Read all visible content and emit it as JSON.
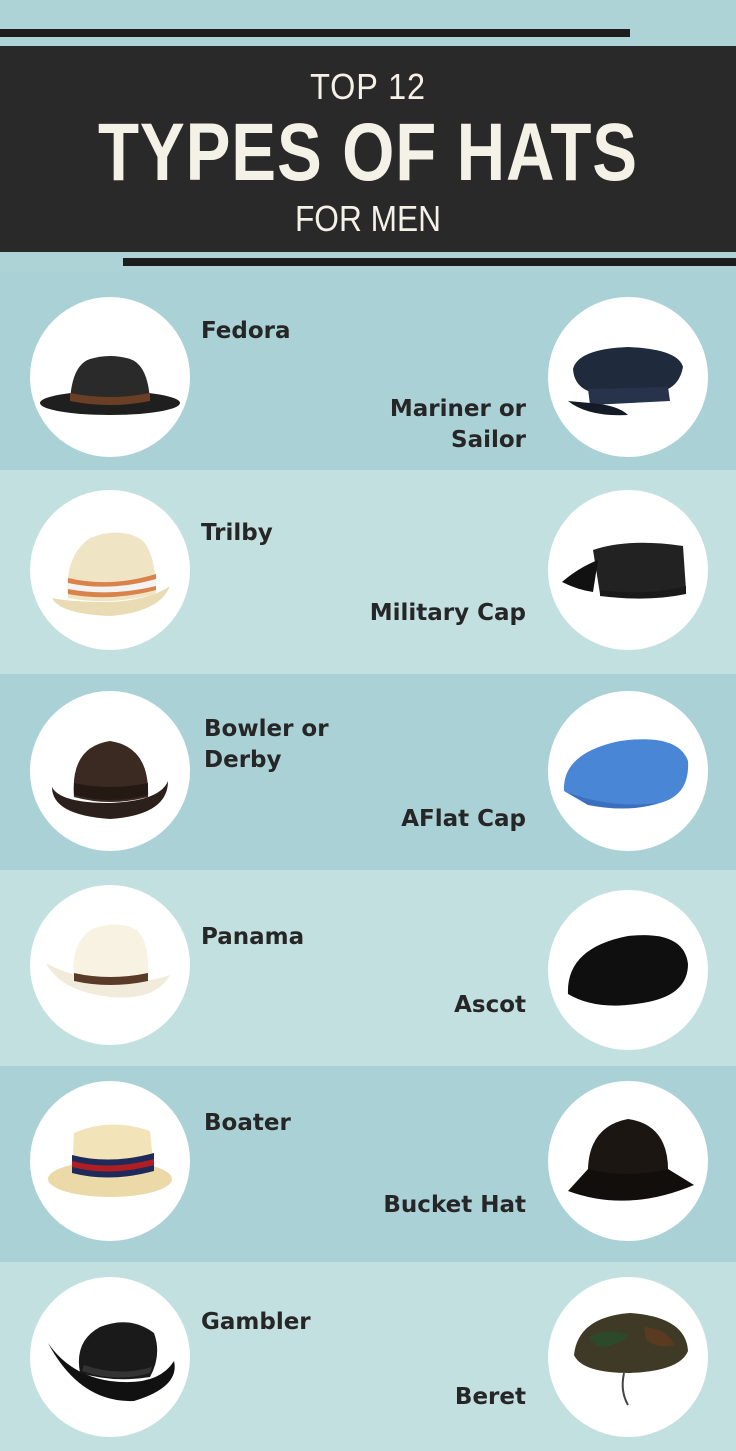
{
  "header": {
    "top": "TOP 12",
    "title": "TYPES OF HATS",
    "sub": "FOR MEN"
  },
  "hats": [
    {
      "left": {
        "name": "Fedora",
        "icon": "fedora-icon"
      },
      "right": {
        "name": "Mariner or\nSailor",
        "icon": "mariner-cap-icon"
      }
    },
    {
      "left": {
        "name": "Trilby",
        "icon": "trilby-icon"
      },
      "right": {
        "name": "Military Cap",
        "icon": "military-cap-icon"
      }
    },
    {
      "left": {
        "name": "Bowler or\nDerby",
        "icon": "bowler-icon"
      },
      "right": {
        "name": "AFlat Cap",
        "icon": "flat-cap-icon"
      }
    },
    {
      "left": {
        "name": "Panama",
        "icon": "panama-icon"
      },
      "right": {
        "name": "Ascot",
        "icon": "ascot-icon"
      }
    },
    {
      "left": {
        "name": "Boater",
        "icon": "boater-icon"
      },
      "right": {
        "name": "Bucket Hat",
        "icon": "bucket-hat-icon"
      }
    },
    {
      "left": {
        "name": "Gambler",
        "icon": "gambler-icon"
      },
      "right": {
        "name": "Beret",
        "icon": "beret-icon"
      }
    }
  ],
  "colors": {
    "band_dark": "#aad2d6",
    "band_light": "#c3e0e0",
    "banner": "#292929",
    "text": "#262626"
  }
}
